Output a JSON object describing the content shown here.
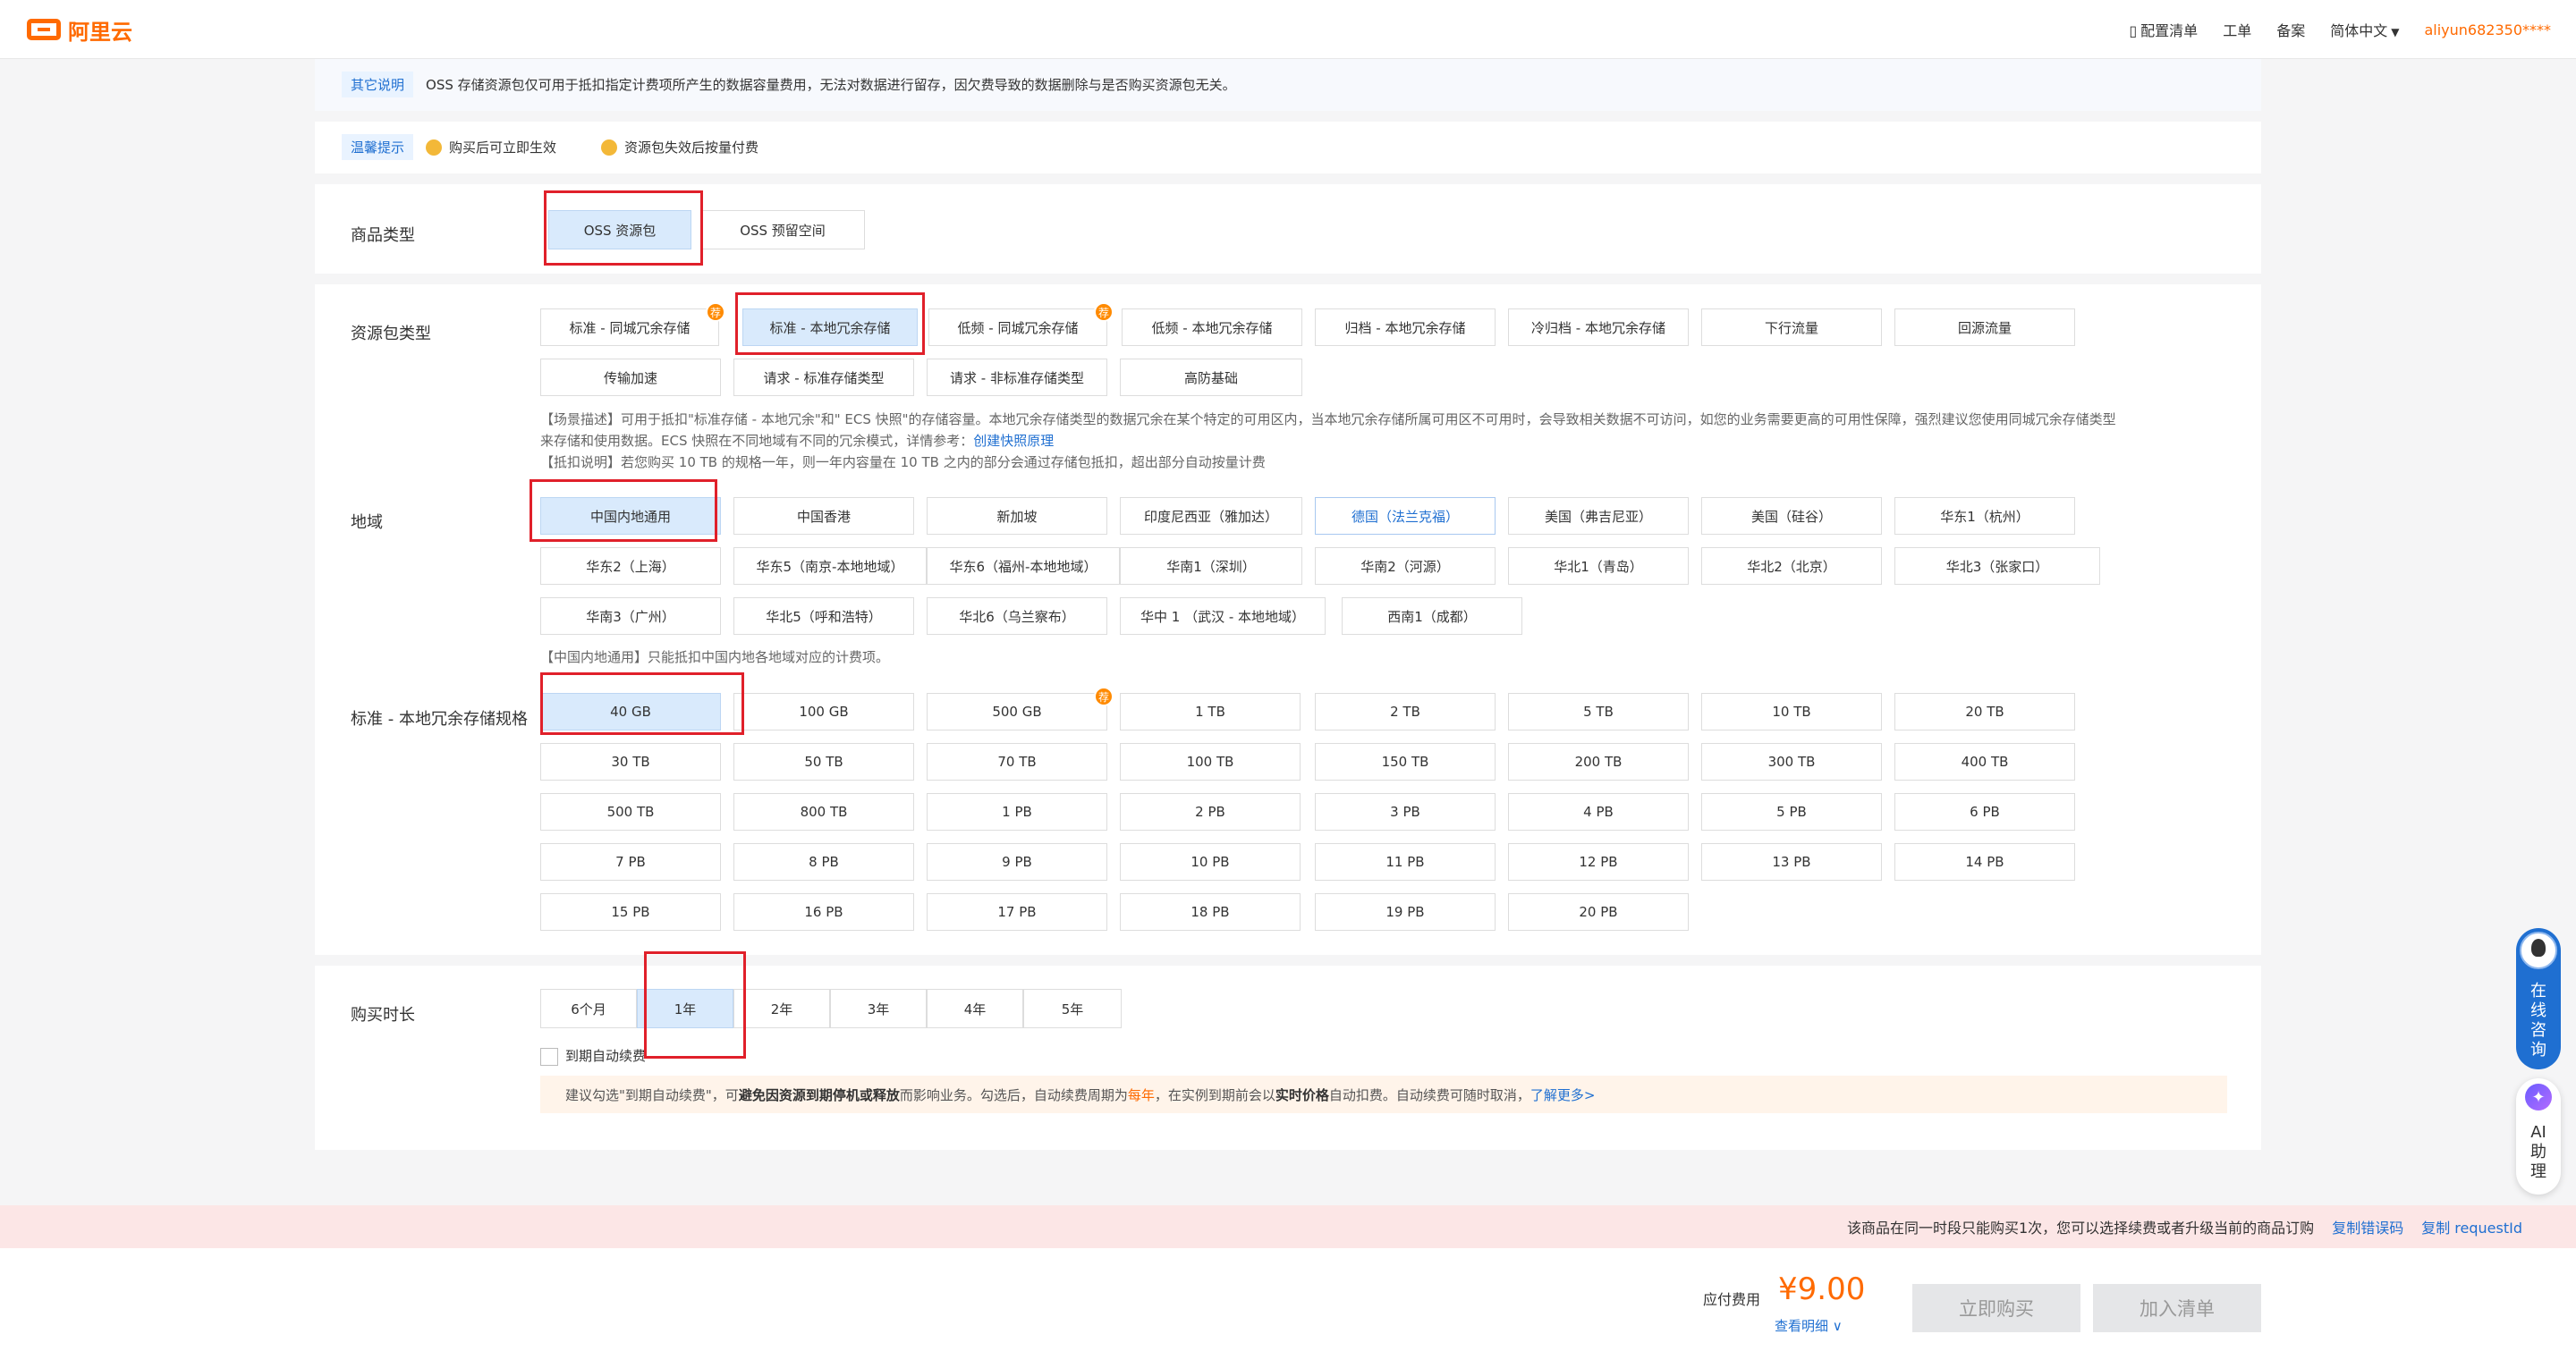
{
  "header": {
    "logo": "阿里云",
    "nav": {
      "config_list": "配置清单",
      "ticket": "工单",
      "icp": "备案",
      "lang": "简体中文",
      "user": "aliyun682350****"
    }
  },
  "other_note": {
    "tag": "其它说明",
    "text": "OSS 存储资源包仅可用于抵扣指定计费项所产生的数据容量费用，无法对数据进行留存，因欠费导致的数据删除与是否购买资源包无关。"
  },
  "tips": {
    "tag": "温馨提示",
    "items": [
      "购买后可立即生效",
      "资源包失效后按量付费"
    ]
  },
  "product_type": {
    "label": "商品类型",
    "options": [
      "OSS 资源包",
      "OSS 预留空间"
    ]
  },
  "package_type": {
    "label": "资源包类型",
    "options": [
      "标准 - 同城冗余存储",
      "标准 - 本地冗余存储",
      "低频 - 同城冗余存储",
      "低频 - 本地冗余存储",
      "归档 - 本地冗余存储",
      "冷归档 - 本地冗余存储",
      "下行流量",
      "回源流量",
      "传输加速",
      "请求 - 标准存储类型",
      "请求 - 非标准存储类型",
      "高防基础"
    ],
    "badge": "荐",
    "desc1": "【场景描述】可用于抵扣\"标准存储 - 本地冗余\"和\" ECS 快照\"的存储容量。本地冗余存储类型的数据冗余在某个特定的可用区内，当本地冗余存储所属可用区不可用时，会导致相关数据不可访问，如您的业务需要更高的可用性保障，强烈建议您使用同城冗余存储类型",
    "desc2": "来存储和使用数据。ECS 快照在不同地域有不同的冗余模式，详情参考：",
    "desc2_link": "创建快照原理",
    "desc3": "【抵扣说明】若您购买 10 TB 的规格一年，则一年内容量在 10 TB 之内的部分会通过存储包抵扣，超出部分自动按量计费"
  },
  "region": {
    "label": "地域",
    "options": [
      "中国内地通用",
      "中国香港",
      "新加坡",
      "印度尼西亚（雅加达）",
      "德国（法兰克福）",
      "美国（弗吉尼亚）",
      "美国（硅谷）",
      "华东1（杭州）",
      "华东2（上海）",
      "华东5（南京-本地地域）",
      "华东6（福州-本地地域）",
      "华南1（深圳）",
      "华南2（河源）",
      "华北1（青岛）",
      "华北2（北京）",
      "华北3（张家口）",
      "华南3（广州）",
      "华北5（呼和浩特）",
      "华北6（乌兰察布）",
      "华中 1 （武汉 - 本地地域）",
      "西南1（成都）"
    ],
    "note": "【中国内地通用】只能抵扣中国内地各地域对应的计费项。"
  },
  "spec": {
    "label": "标准 - 本地冗余存储规格",
    "options": [
      "40 GB",
      "100 GB",
      "500 GB",
      "1 TB",
      "2 TB",
      "5 TB",
      "10 TB",
      "20 TB",
      "30 TB",
      "50 TB",
      "70 TB",
      "100 TB",
      "150 TB",
      "200 TB",
      "300 TB",
      "400 TB",
      "500 TB",
      "800 TB",
      "1 PB",
      "2 PB",
      "3 PB",
      "4 PB",
      "5 PB",
      "6 PB",
      "7 PB",
      "8 PB",
      "9 PB",
      "10 PB",
      "11 PB",
      "12 PB",
      "13 PB",
      "14 PB",
      "15 PB",
      "16 PB",
      "17 PB",
      "18 PB",
      "19 PB",
      "20 PB"
    ],
    "badge": "荐"
  },
  "duration": {
    "label": "购买时长",
    "options": [
      "6个月",
      "1年",
      "2年",
      "3年",
      "4年",
      "5年"
    ],
    "auto_renew": "到期自动续费",
    "tip_a": "建议勾选\"到期自动续费\"，可",
    "tip_b": "避免因资源到期停机或释放",
    "tip_c": "而影响业务。勾选后，自动续费周期为 ",
    "tip_d": "每年",
    "tip_e": "，在实例到期前会以",
    "tip_f": "实时价格",
    "tip_g": "自动扣费。自动续费可随时取消，",
    "tip_link": "了解更多>"
  },
  "limit_bar": {
    "text": "该商品在同一时段只能购买1次，您可以选择续费或者升级当前的商品订购",
    "copy_error": "复制错误码",
    "copy_req": "复制 requestId"
  },
  "footer": {
    "price_label": "应付费用",
    "price": "¥9.00",
    "detail": "查看明细 ∨",
    "buy": "立即购买",
    "add": "加入清单"
  },
  "floats": {
    "consult": [
      "在",
      "线",
      "咨",
      "询"
    ],
    "ai": [
      "AI",
      "助",
      "理"
    ]
  }
}
